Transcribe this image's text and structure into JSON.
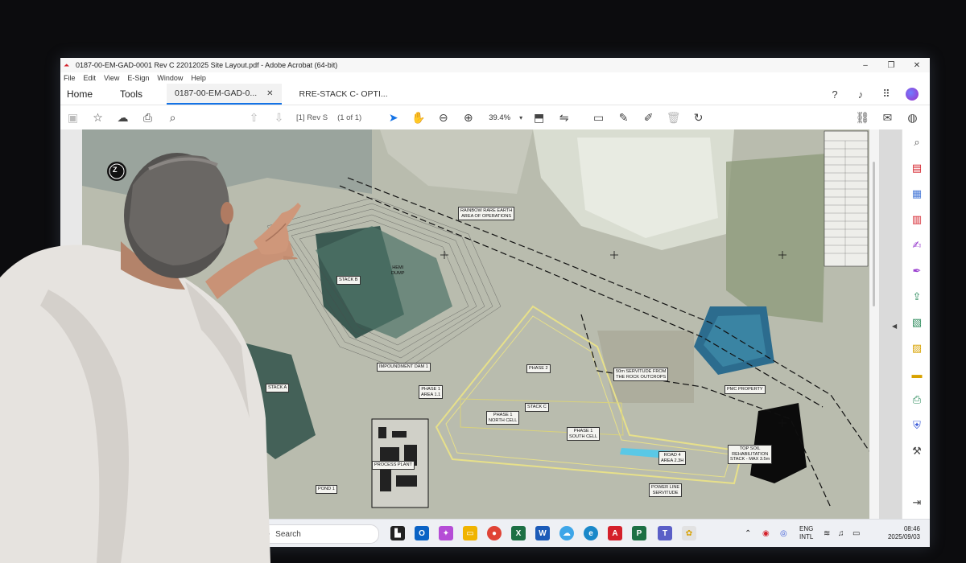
{
  "window": {
    "title": "0187-00-EM-GAD-0001 Rev C 22012025 Site Layout.pdf - Adobe Acrobat (64-bit)",
    "menu": [
      "File",
      "Edit",
      "View",
      "E-Sign",
      "Window",
      "Help"
    ]
  },
  "tabs": {
    "home": "Home",
    "tools": "Tools",
    "doc_tabs": [
      {
        "label": "0187-00-EM-GAD-0...",
        "active": true
      },
      {
        "label": "RRE-STACK C- OPTI...",
        "active": false
      }
    ]
  },
  "toolbar": {
    "page_label": "[1] Rev S",
    "page_count": "(1 of 1)",
    "zoom": "39.4%",
    "accent_color": "#1473e6"
  },
  "map": {
    "labels": {
      "rainbow": "RAINBOW RARE EARTH\nAREA OF OPERATIONS",
      "stack_b": "STACK B",
      "hemi_dump": "HEMI\nDUMP",
      "stack_a": "STACK A",
      "impoundment_dam": "IMPOUNDMENT DAM 1",
      "phase_area": "PHASE 1\nAREA 1.1",
      "phase2": "PHASE 2",
      "stack_c": "STACK C",
      "phase1_north": "PHASE 1\nNORTH CELL",
      "phase1_south": "PHASE 1\nSOUTH CELL",
      "servitude": "50m SERVITUDE FROM\nTHE ROCK OUTCROPS",
      "pmc_property": "PMC PROPERTY",
      "top_soil": "TOP SOIL\nREHABILITATION\nSTACK - MAX 3.5m",
      "process_plant": "PROCESS PLANT",
      "power_line": "POWER LINE\nSERVITUDE",
      "pond": "POND 1",
      "road": "ROAD 4\nAREA 2.3H",
      "compass": "Z"
    }
  },
  "taskbar": {
    "search_placeholder": "Search",
    "lang_line1": "ENG",
    "lang_line2": "INTL",
    "time": "08:46",
    "date": "2025/09/03"
  }
}
